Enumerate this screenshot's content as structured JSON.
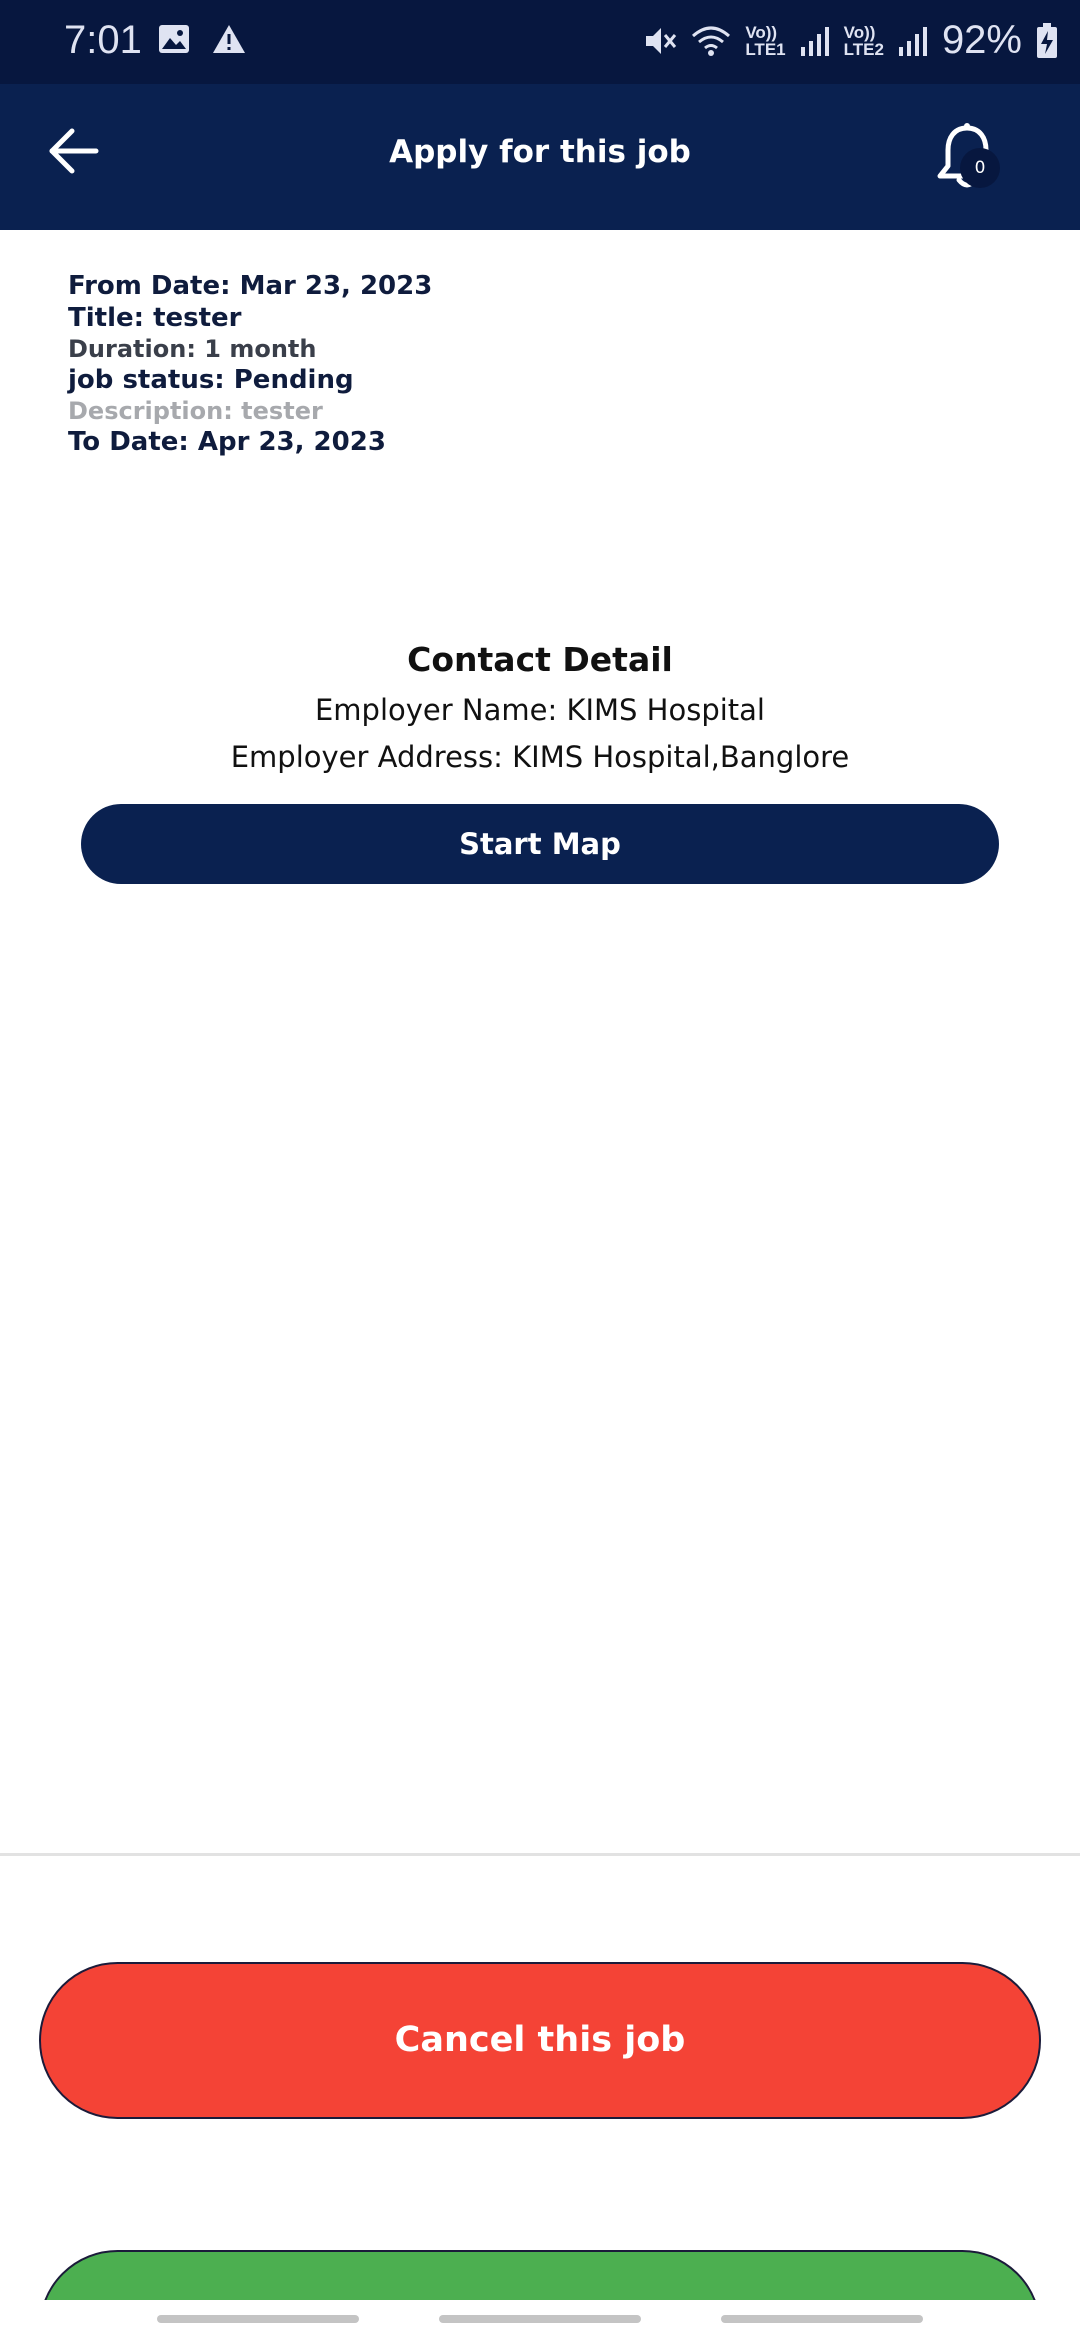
{
  "status_bar": {
    "time": "7:01",
    "battery": "92%",
    "lte1": [
      "Vo))",
      "LTE1"
    ],
    "lte2": [
      "Vo))",
      "LTE2"
    ],
    "icons": [
      "image-icon",
      "warning-icon",
      "mute-icon",
      "wifi-icon",
      "signal-icon",
      "battery-charging-icon"
    ]
  },
  "app_bar": {
    "title": "Apply for this job",
    "notification_count": "0"
  },
  "job": {
    "from_date": "From Date: Mar 23, 2023",
    "title": "Title: tester",
    "duration": "Duration: 1 month",
    "status": "job status: Pending",
    "description": "Description: tester",
    "to_date": "To Date: Apr 23, 2023"
  },
  "contact": {
    "heading": "Contact Detail",
    "employer_name": "Employer Name: KIMS Hospital",
    "employer_address": "Employer Address: KIMS Hospital,Banglore",
    "start_map_label": "Start Map"
  },
  "actions": {
    "cancel_label": "Cancel this job"
  },
  "colors": {
    "primary": "#0a2150",
    "status_bar": "#07173f",
    "cancel": "#f44336",
    "accept": "#4caf50"
  }
}
